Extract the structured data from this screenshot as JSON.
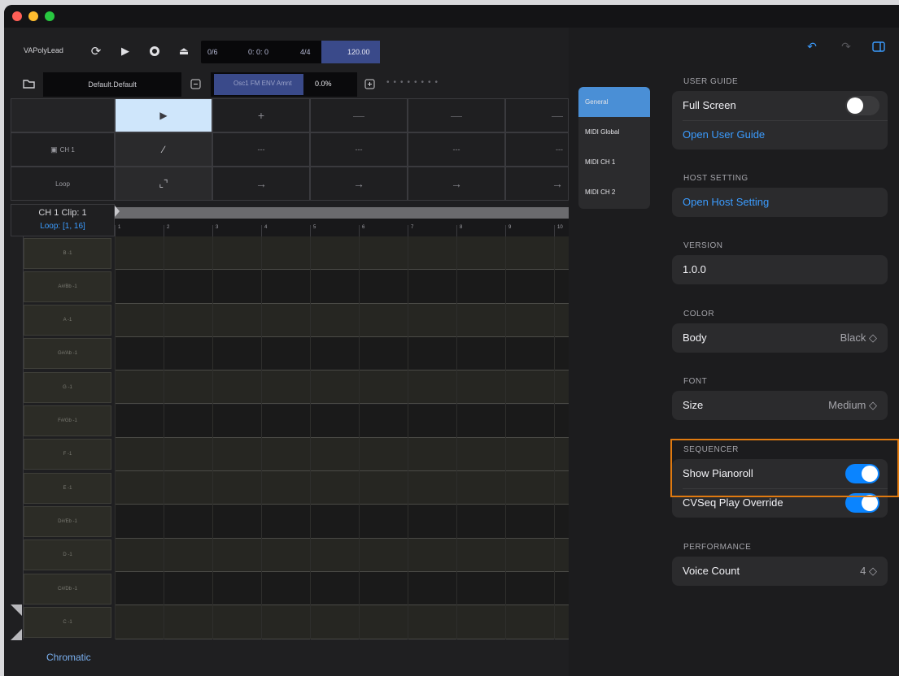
{
  "toolbar": {
    "preset": "VAPolyLead",
    "lcd_position": "0/6",
    "lcd_time": "0: 0: 0",
    "lcd_signature": "4/4",
    "lcd_tempo": "120.00",
    "preset_bank": "Default.Default",
    "param_name": "Osc1 FM ENV Amnt",
    "param_value": "0.0%"
  },
  "grid": {
    "header_cells": [
      "+",
      "—",
      "—",
      "—"
    ],
    "ch_label": "CH 1",
    "ch_cells": [
      "---",
      "---",
      "---",
      "---"
    ],
    "loop_label": "Loop",
    "loop_cells": [
      "→",
      "→",
      "→",
      "→"
    ]
  },
  "roll": {
    "clip_title": "CH 1 Clip: 1",
    "loop_range": "Loop: [1, 16]",
    "beats": [
      "1",
      "2",
      "3",
      "4",
      "5",
      "6",
      "7",
      "8",
      "9",
      "10"
    ],
    "keys": [
      "B -1",
      "A#/Bb -1",
      "A -1",
      "G#/Ab -1",
      "G -1",
      "F#/Gb -1",
      "F -1",
      "E -1",
      "D#/Eb -1",
      "D -1",
      "C#/Db -1",
      "C -1"
    ],
    "scale": "Chromatic"
  },
  "settings": {
    "tabs": [
      "General",
      "MIDI Global",
      "MIDI CH 1",
      "MIDI CH 2"
    ],
    "user_guide": {
      "header": "USER GUIDE",
      "full_screen": "Full Screen",
      "full_screen_on": false,
      "open_guide": "Open User Guide"
    },
    "host": {
      "header": "HOST SETTING",
      "open_host": "Open Host Setting"
    },
    "version": {
      "header": "VERSION",
      "value": "1.0.0"
    },
    "color": {
      "header": "COLOR",
      "label": "Body",
      "value": "Black ◇"
    },
    "font": {
      "header": "FONT",
      "label": "Size",
      "value": "Medium ◇"
    },
    "sequencer": {
      "header": "SEQUENCER",
      "show_pianoroll": "Show Pianoroll",
      "show_pianoroll_on": true,
      "cvseq_override": "CVSeq Play Override",
      "cvseq_override_on": true
    },
    "performance": {
      "header": "PERFORMANCE",
      "voice_count": "Voice Count",
      "voice_count_value": "4 ◇"
    }
  },
  "colors": {
    "accent": "#0a84ff",
    "link": "#3b9cff",
    "tab_selected": "#4a8fd6",
    "highlight": "#e07a10"
  }
}
